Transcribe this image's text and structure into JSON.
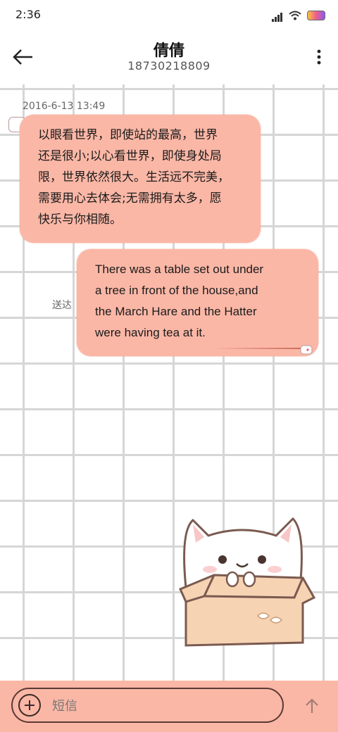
{
  "status_bar": {
    "time": "2:36",
    "icons": [
      "signal-icon",
      "wifi-icon",
      "battery-icon"
    ]
  },
  "header": {
    "contact_name": "倩倩",
    "contact_number": "18730218809",
    "back_icon": "back-arrow-icon",
    "more_icon": "more-vert-icon"
  },
  "conversation": {
    "timestamp": "2016-6-13 13:49",
    "messages": [
      {
        "direction": "incoming",
        "lines": [
          "以眼看世界，即使站的最高，世界",
          "还是很小;以心看世界，即使身处局",
          "限，世界依然很大。生活远不完美，",
          "需要用心去体会;无需拥有太多，愿",
          "快乐与你相随。"
        ]
      },
      {
        "direction": "outgoing",
        "status": "送达",
        "lines": [
          "There was a table set out under",
          "a tree in front of the house,and",
          "the March Hare and the Hatter",
          "were having tea at it."
        ]
      }
    ]
  },
  "composer": {
    "placeholder": "短信",
    "attach_icon": "plus-circle-icon",
    "send_icon": "send-arrow-up-icon"
  },
  "theme": {
    "bubble_color": "#fbb7a6",
    "bottom_bar_color": "#fbb7a6",
    "grid_line_color": "#d6d6d6"
  }
}
